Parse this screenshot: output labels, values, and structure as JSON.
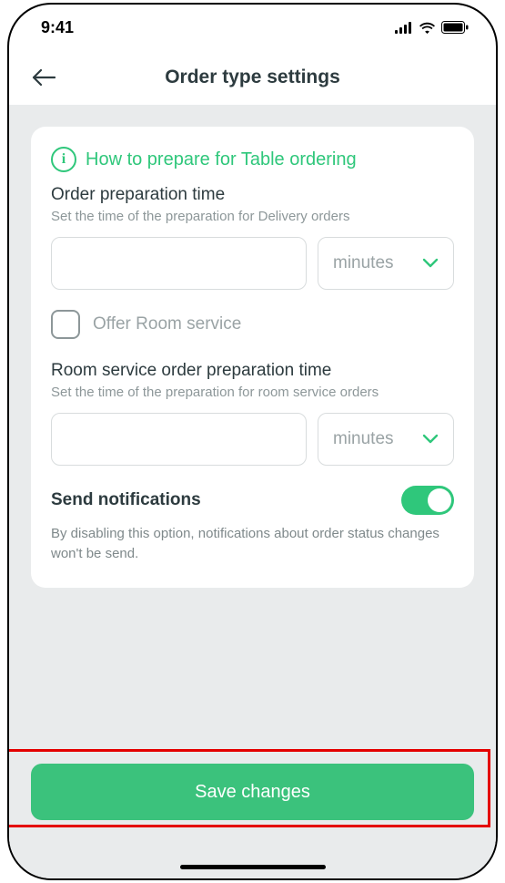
{
  "status": {
    "time": "9:41"
  },
  "header": {
    "title": "Order type settings"
  },
  "info": {
    "icon_char": "i",
    "text": "How to prepare for Table ordering"
  },
  "prep": {
    "label": "Order preparation time",
    "desc": "Set the time of the preparation for Delivery orders",
    "value": "",
    "unit": "minutes"
  },
  "room_checkbox": {
    "label": "Offer Room service",
    "checked": false
  },
  "room_prep": {
    "label": "Room service order preparation time",
    "desc": "Set the time of the preparation for room service orders",
    "value": "",
    "unit": "minutes"
  },
  "notifications": {
    "label": "Send notifications",
    "desc": "By disabling this option, notifications about order status changes won't be send.",
    "enabled": true
  },
  "save_label": "Save changes",
  "colors": {
    "accent": "#2fc77b",
    "highlight": "#e40000"
  }
}
